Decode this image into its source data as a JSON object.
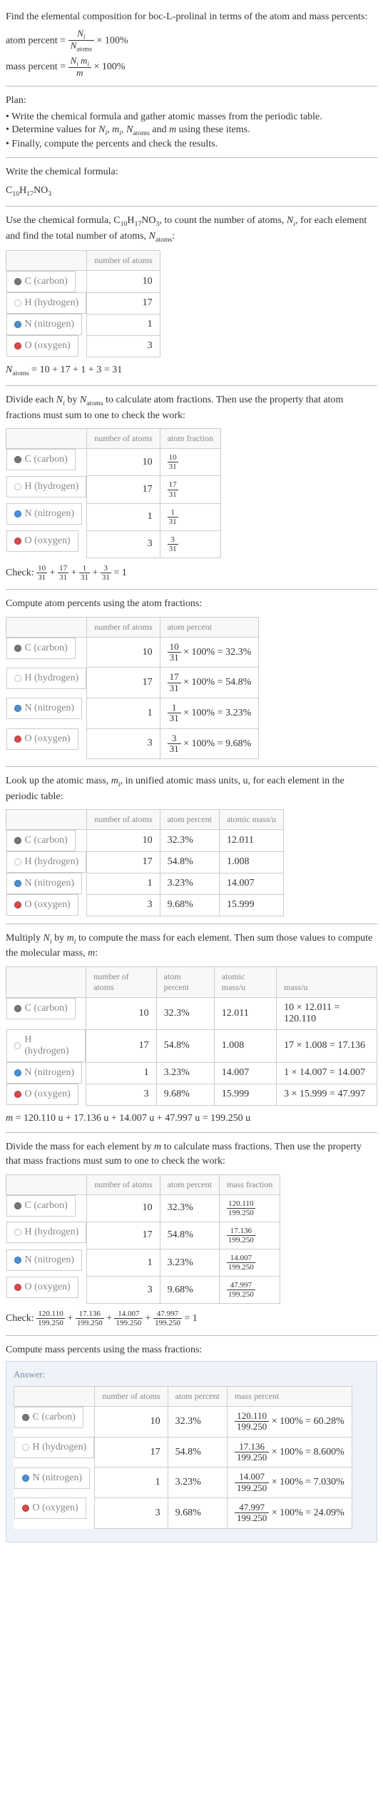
{
  "intro": "Find the elemental composition for boc-L-prolinal in terms of the atom and mass percents:",
  "formula_atom": "atom percent = ",
  "formula_mass": "mass percent = ",
  "atom_frac_num": "N_i",
  "atom_frac_den": "N_atoms",
  "mass_frac_num": "N_i m_i",
  "mass_frac_den": "199.250",
  "times100": " × 100%",
  "plan_label": "Plan:",
  "plan_items": [
    "Write the chemical formula and gather atomic masses from the periodic table.",
    "Determine values for N_i, m_i, N_atoms and m using these items.",
    "Finally, compute the percents and check the results."
  ],
  "write_formula_text": "Write the chemical formula:",
  "molecule_prefix": "C",
  "molecule": "C_10H_17NO_3",
  "use_formula_text_a": "Use the chemical formula, ",
  "use_formula_text_b": ", to count the number of atoms, N_i, for each element and find the total number of atoms, N_atoms:",
  "headers": {
    "number_of_atoms": "number of atoms",
    "atom_fraction": "atom fraction",
    "atom_percent": "atom percent",
    "atomic_mass": "atomic mass/u",
    "mass_u": "mass/u",
    "mass_fraction": "mass fraction",
    "mass_percent": "mass percent"
  },
  "elements": [
    {
      "sym": "C",
      "name": "C (carbon)",
      "dot": "dot-c",
      "n": 10,
      "frac_num": "10",
      "frac_den": "31",
      "atom_pct": "32.3%",
      "amu": "12.011",
      "mass_expr": "10 × 12.011 = 120.110",
      "mass_val": "120.110",
      "mass_frac_num": "120.110",
      "mass_pct": "60.28%"
    },
    {
      "sym": "H",
      "name": "H (hydrogen)",
      "dot": "dot-h",
      "n": 17,
      "frac_num": "17",
      "frac_den": "31",
      "atom_pct": "54.8%",
      "amu": "1.008",
      "mass_expr": "17 × 1.008 = 17.136",
      "mass_val": "17.136",
      "mass_frac_num": "17.136",
      "mass_pct": "8.600%"
    },
    {
      "sym": "N",
      "name": "N (nitrogen)",
      "dot": "dot-n",
      "n": 1,
      "frac_num": "1",
      "frac_den": "31",
      "atom_pct": "3.23%",
      "amu": "14.007",
      "mass_expr": "1 × 14.007 = 14.007",
      "mass_val": "14.007",
      "mass_frac_num": "14.007",
      "mass_pct": "7.030%"
    },
    {
      "sym": "O",
      "name": "O (oxygen)",
      "dot": "dot-o",
      "n": 3,
      "frac_num": "3",
      "frac_den": "31",
      "atom_pct": "9.68%",
      "amu": "15.999",
      "mass_expr": "3 × 15.999 = 47.997",
      "mass_val": "47.997",
      "mass_frac_num": "47.997",
      "mass_pct": "24.09%"
    }
  ],
  "n_atoms_line": "N_atoms = 10 + 17 + 1 + 3 = 31",
  "divide_text": "Divide each N_i by N_atoms to calculate atom fractions. Then use the property that atom fractions must sum to one to check the work:",
  "check_label": "Check: ",
  "check_frac_den": "31",
  "check_equals": " = 1",
  "compute_atom_pct": "Compute atom percents using the atom fractions:",
  "atom_pct_suffix": " × 100% = ",
  "lookup_text": "Look up the atomic mass, m_i, in unified atomic mass units, u, for each element in the periodic table:",
  "multiply_text": "Multiply N_i by m_i to compute the mass for each element. Then sum those values to compute the molecular mass, m:",
  "m_line": "m = 120.110 u + 17.136 u + 14.007 u + 47.997 u = 199.250 u",
  "divide_mass_text": "Divide the mass for each element by m to calculate mass fractions. Then use the property that mass fractions must sum to one to check the work:",
  "compute_mass_pct": "Compute mass percents using the mass fractions:",
  "answer_label": "Answer:"
}
